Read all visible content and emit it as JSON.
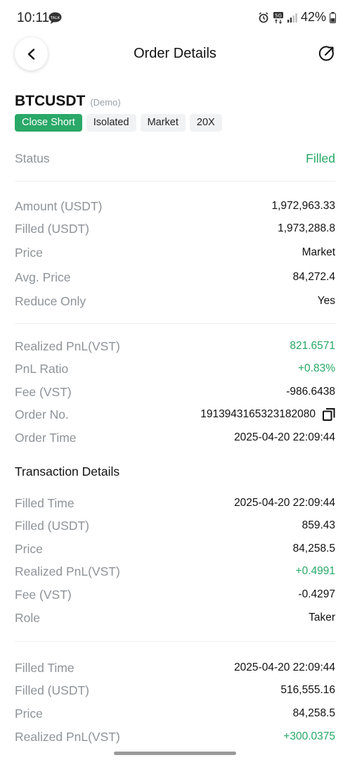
{
  "status_bar": {
    "time": "10:11",
    "talk_badge": "TALK",
    "network": "5G",
    "battery": "42%"
  },
  "header": {
    "title": "Order Details"
  },
  "order": {
    "symbol": "BTCUSDT",
    "mode": "(Demo)",
    "tags": [
      "Close Short",
      "Isolated",
      "Market",
      "20X"
    ],
    "status": {
      "label": "Status",
      "value": "Filled"
    },
    "amount": {
      "label": "Amount (USDT)",
      "value": "1,972,963.33"
    },
    "filled": {
      "label": "Filled (USDT)",
      "value": "1,973,288.8"
    },
    "price": {
      "label": "Price",
      "value": "Market"
    },
    "avg_price": {
      "label": "Avg. Price",
      "value": "84,272.4"
    },
    "reduce_only": {
      "label": "Reduce Only",
      "value": "Yes"
    },
    "realized_pnl": {
      "label": "Realized PnL(VST)",
      "value": "821.6571"
    },
    "pnl_ratio": {
      "label": "PnL Ratio",
      "value": "+0.83%"
    },
    "fee": {
      "label": "Fee (VST)",
      "value": "-986.6438"
    },
    "order_no": {
      "label": "Order No.",
      "value": "1913943165323182080"
    },
    "order_time": {
      "label": "Order Time",
      "value": "2025-04-20 22:09:44"
    }
  },
  "transactions": {
    "title": "Transaction Details",
    "items": [
      {
        "filled_time": {
          "label": "Filled Time",
          "value": "2025-04-20 22:09:44"
        },
        "filled": {
          "label": "Filled (USDT)",
          "value": "859.43"
        },
        "price": {
          "label": "Price",
          "value": "84,258.5"
        },
        "realized_pnl": {
          "label": "Realized PnL(VST)",
          "value": "+0.4991"
        },
        "fee": {
          "label": "Fee (VST)",
          "value": "-0.4297"
        },
        "role": {
          "label": "Role",
          "value": "Taker"
        }
      },
      {
        "filled_time": {
          "label": "Filled Time",
          "value": "2025-04-20 22:09:44"
        },
        "filled": {
          "label": "Filled (USDT)",
          "value": "516,555.16"
        },
        "price": {
          "label": "Price",
          "value": "84,258.5"
        },
        "realized_pnl": {
          "label": "Realized PnL(VST)",
          "value": "+300.0375"
        }
      }
    ]
  },
  "colors": {
    "accent_green": "#27a866",
    "tag_green": "#2aa868",
    "label_gray": "#8e9399"
  },
  "icons": [
    "back-arrow-icon",
    "share-icon",
    "copy-icon",
    "alarm-icon",
    "signal-icon",
    "battery-icon",
    "talk-icon"
  ]
}
